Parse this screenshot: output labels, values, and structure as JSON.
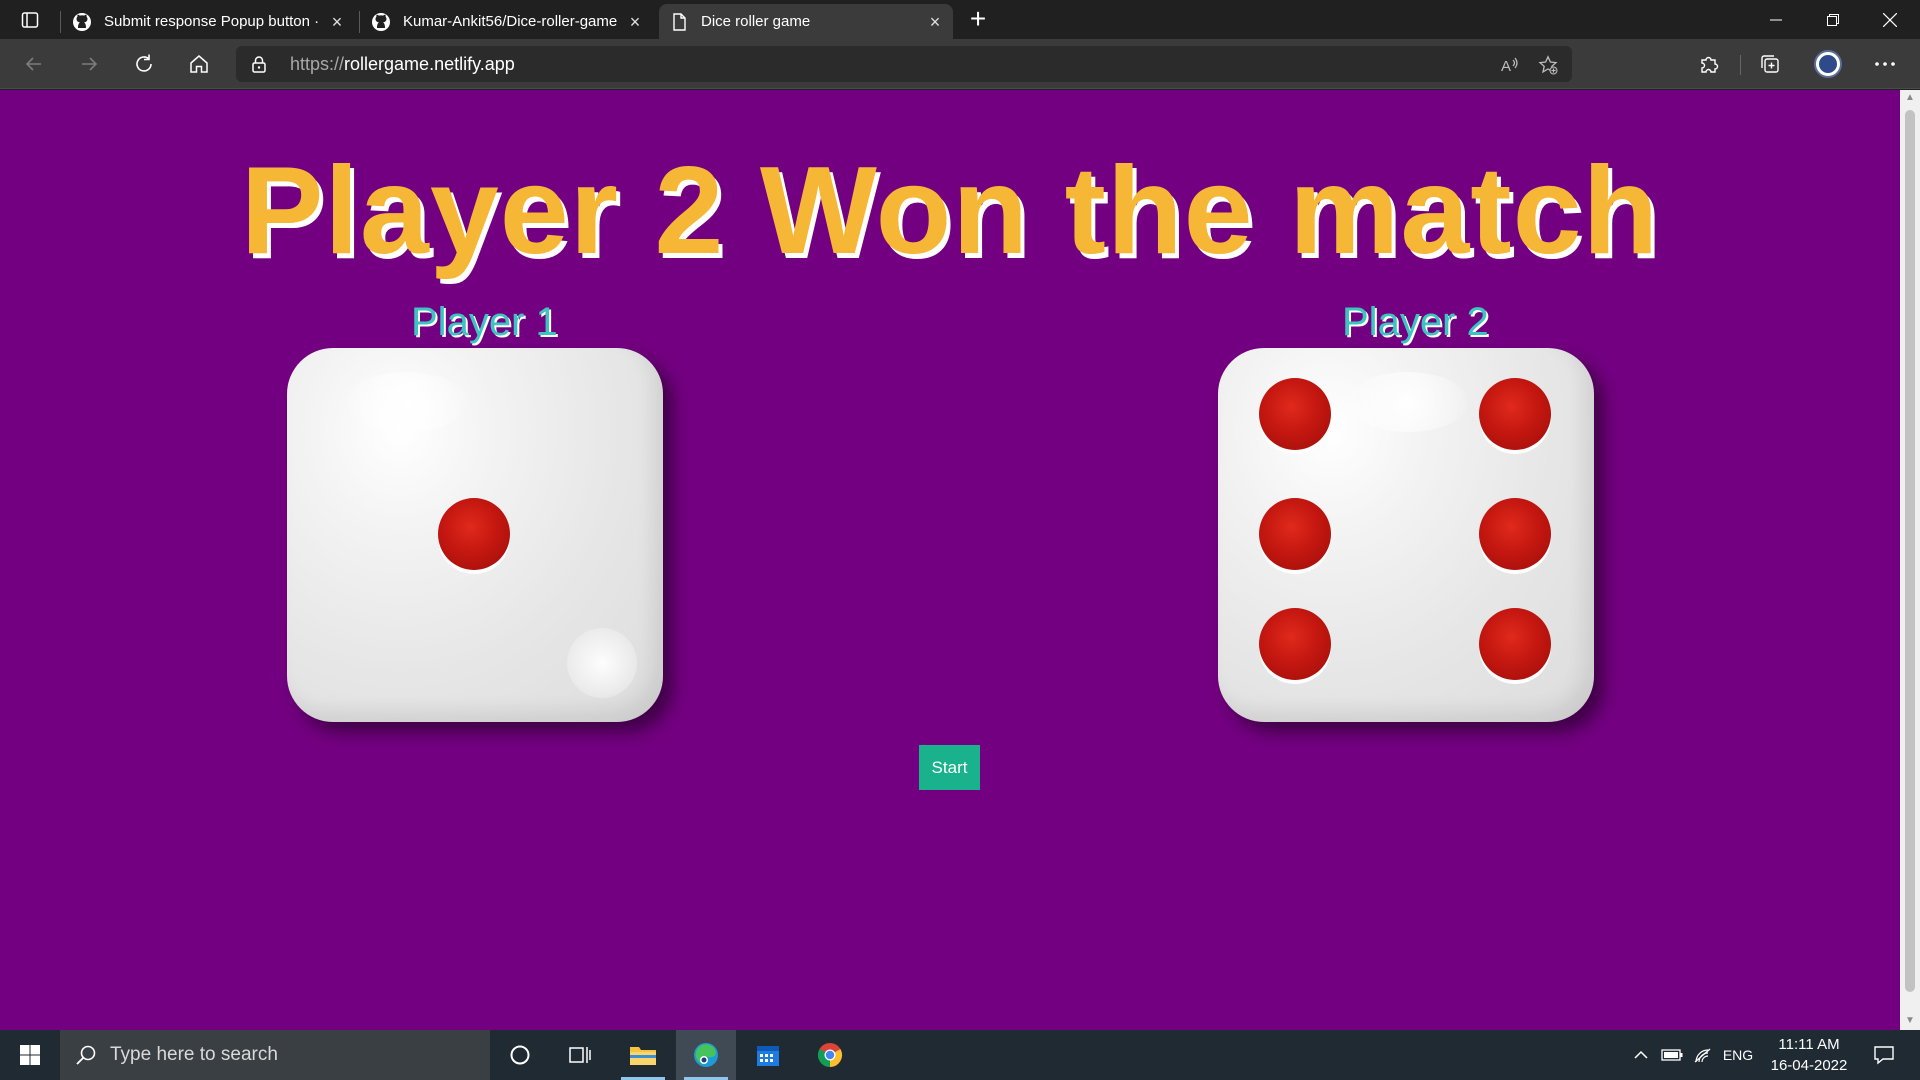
{
  "browser": {
    "tabs": [
      {
        "label": "Submit response Popup button ·",
        "icon": "github-icon"
      },
      {
        "label": "Kumar-Ankit56/Dice-roller-game",
        "icon": "github-icon"
      },
      {
        "label": "Dice roller game",
        "icon": "page-icon"
      }
    ],
    "address": {
      "protocol": "https://",
      "host": "rollergame.netlify.app"
    }
  },
  "game": {
    "headline": "Player 2 Won the match",
    "player1": {
      "label": "Player 1",
      "die_value": 1
    },
    "player2": {
      "label": "Player 2",
      "die_value": 6
    },
    "start_label": "Start",
    "colors": {
      "background": "#730080",
      "headline": "#f5b735",
      "player_label": "#3ec3c3",
      "pip": "#c41710",
      "button": "#1ab28c"
    }
  },
  "taskbar": {
    "search_placeholder": "Type here to search",
    "language": "ENG",
    "time": "11:11 AM",
    "date": "16-04-2022",
    "pinned": [
      "cortana-icon",
      "task-view-icon",
      "file-explorer-icon",
      "edge-icon",
      "calendar-icon",
      "chrome-icon"
    ]
  }
}
